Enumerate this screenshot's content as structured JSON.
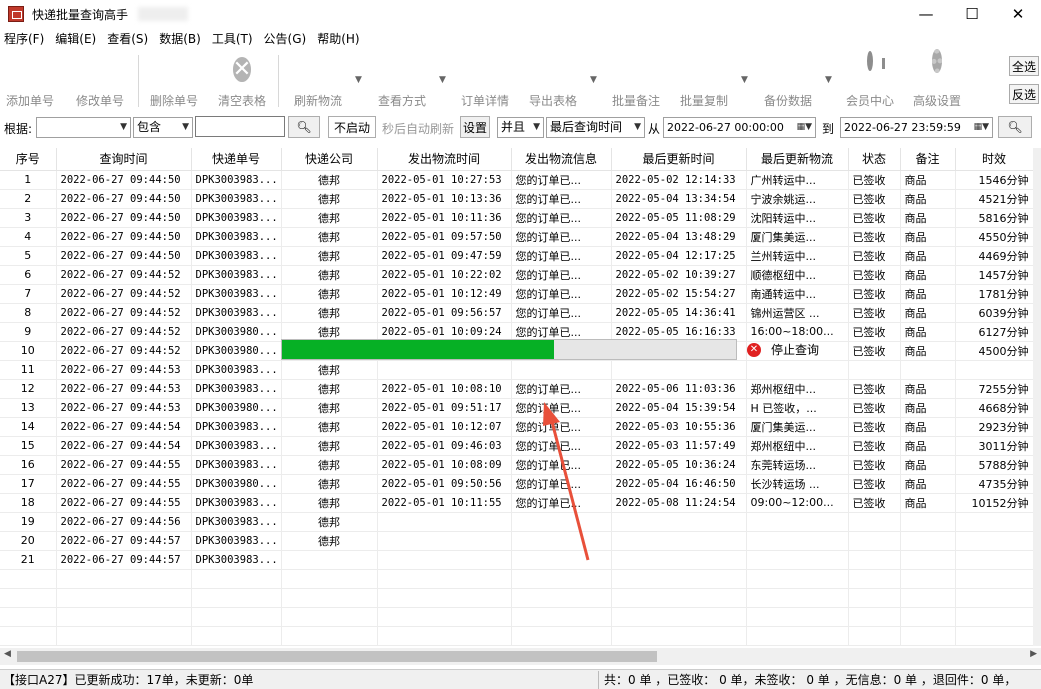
{
  "window": {
    "title": "快递批量查询高手",
    "min": "—",
    "max": "☐",
    "close": "✕"
  },
  "menu": [
    "程序(F)",
    "编辑(E)",
    "查看(S)",
    "数据(B)",
    "工具(T)",
    "公告(G)",
    "帮助(H)"
  ],
  "toolbar": {
    "add": "添加单号",
    "edit": "修改单号",
    "delete": "删除单号",
    "clear": "清空表格",
    "refresh": "刷新物流",
    "view_mode": "查看方式",
    "order_detail": "订单详情",
    "export": "导出表格",
    "batch_note": "批量备注",
    "batch_copy": "批量复制",
    "backup": "备份数据",
    "member": "会员中心",
    "advanced": "高级设置",
    "select_all": "全选",
    "invert": "反选"
  },
  "filter": {
    "by_label": "根据:",
    "field_value": "",
    "match_mode": "包含",
    "keyword": "",
    "auto_refresh": "不启动",
    "auto_refresh_hint": "秒后自动刷新",
    "settings": "设置",
    "logic": "并且",
    "time_field": "最后查询时间",
    "from_label": "从",
    "from_value": "2022-06-27 00:00:00",
    "to_label": "到",
    "to_value": "2022-06-27 23:59:59"
  },
  "columns": [
    "序号",
    "查询时间",
    "快递单号",
    "快递公司",
    "发出物流时间",
    "发出物流信息",
    "最后更新时间",
    "最后更新物流",
    "状态",
    "备注",
    "时效"
  ],
  "rows": [
    [
      "1",
      "2022-06-27 09:44:50",
      "DPK3003983...",
      "德邦",
      "2022-05-01 10:27:53",
      "您的订单已...",
      "2022-05-02 12:14:33",
      "广州转运中...",
      "已签收",
      "商品",
      "1546分钟"
    ],
    [
      "2",
      "2022-06-27 09:44:50",
      "DPK3003983...",
      "德邦",
      "2022-05-01 10:13:36",
      "您的订单已...",
      "2022-05-04 13:34:54",
      "宁波余姚运...",
      "已签收",
      "商品",
      "4521分钟"
    ],
    [
      "3",
      "2022-06-27 09:44:50",
      "DPK3003983...",
      "德邦",
      "2022-05-01 10:11:36",
      "您的订单已...",
      "2022-05-05 11:08:29",
      "沈阳转运中...",
      "已签收",
      "商品",
      "5816分钟"
    ],
    [
      "4",
      "2022-06-27 09:44:50",
      "DPK3003983...",
      "德邦",
      "2022-05-01 09:57:50",
      "您的订单已...",
      "2022-05-04 13:48:29",
      "厦门集美运...",
      "已签收",
      "商品",
      "4550分钟"
    ],
    [
      "5",
      "2022-06-27 09:44:50",
      "DPK3003983...",
      "德邦",
      "2022-05-01 09:47:59",
      "您的订单已...",
      "2022-05-04 12:17:25",
      "兰州转运中...",
      "已签收",
      "商品",
      "4469分钟"
    ],
    [
      "6",
      "2022-06-27 09:44:52",
      "DPK3003983...",
      "德邦",
      "2022-05-01 10:22:02",
      "您的订单已...",
      "2022-05-02 10:39:27",
      "顺德枢纽中...",
      "已签收",
      "商品",
      "1457分钟"
    ],
    [
      "7",
      "2022-06-27 09:44:52",
      "DPK3003983...",
      "德邦",
      "2022-05-01 10:12:49",
      "您的订单已...",
      "2022-05-02 15:54:27",
      "南通转运中...",
      "已签收",
      "商品",
      "1781分钟"
    ],
    [
      "8",
      "2022-06-27 09:44:52",
      "DPK3003983...",
      "德邦",
      "2022-05-01 09:56:57",
      "您的订单已...",
      "2022-05-05 14:36:41",
      "锦州运营区 ...",
      "已签收",
      "商品",
      "6039分钟"
    ],
    [
      "9",
      "2022-06-27 09:44:52",
      "DPK3003980...",
      "德邦",
      "2022-05-01 10:09:24",
      "您的订单已...",
      "2022-05-05 16:16:33",
      "16:00~18:00...",
      "已签收",
      "商品",
      "6127分钟"
    ],
    [
      "10",
      "2022-06-27 09:44:52",
      "DPK3003980...",
      "",
      "",
      "",
      "",
      "",
      "已签收",
      "商品",
      "4500分钟"
    ],
    [
      "11",
      "2022-06-27 09:44:53",
      "DPK3003983...",
      "德邦",
      "",
      "",
      "",
      "",
      "",
      "",
      ""
    ],
    [
      "12",
      "2022-06-27 09:44:53",
      "DPK3003983...",
      "德邦",
      "2022-05-01 10:08:10",
      "您的订单已...",
      "2022-05-06 11:03:36",
      "郑州枢纽中...",
      "已签收",
      "商品",
      "7255分钟"
    ],
    [
      "13",
      "2022-06-27 09:44:53",
      "DPK3003980...",
      "德邦",
      "2022-05-01 09:51:17",
      "您的订单已...",
      "2022-05-04 15:39:54",
      "H 已签收，...",
      "已签收",
      "商品",
      "4668分钟"
    ],
    [
      "14",
      "2022-06-27 09:44:54",
      "DPK3003983...",
      "德邦",
      "2022-05-01 10:12:07",
      "您的订单已...",
      "2022-05-03 10:55:36",
      "厦门集美运...",
      "已签收",
      "商品",
      "2923分钟"
    ],
    [
      "15",
      "2022-06-27 09:44:54",
      "DPK3003983...",
      "德邦",
      "2022-05-01 09:46:03",
      "您的订单已...",
      "2022-05-03 11:57:49",
      "郑州枢纽中...",
      "已签收",
      "商品",
      "3011分钟"
    ],
    [
      "16",
      "2022-06-27 09:44:55",
      "DPK3003983...",
      "德邦",
      "2022-05-01 10:08:09",
      "您的订单已...",
      "2022-05-05 10:36:24",
      "东莞转运场...",
      "已签收",
      "商品",
      "5788分钟"
    ],
    [
      "17",
      "2022-06-27 09:44:55",
      "DPK3003980...",
      "德邦",
      "2022-05-01 09:50:56",
      "您的订单已...",
      "2022-05-04 16:46:50",
      "长沙转运场 ...",
      "已签收",
      "商品",
      "4735分钟"
    ],
    [
      "18",
      "2022-06-27 09:44:55",
      "DPK3003983...",
      "德邦",
      "2022-05-01 10:11:55",
      "您的订单已...",
      "2022-05-08 11:24:54",
      "09:00~12:00...",
      "已签收",
      "商品",
      "10152分钟"
    ],
    [
      "19",
      "2022-06-27 09:44:56",
      "DPK3003983...",
      "德邦",
      "",
      "",
      "",
      "",
      "",
      "",
      ""
    ],
    [
      "20",
      "2022-06-27 09:44:57",
      "DPK3003983...",
      "德邦",
      "",
      "",
      "",
      "",
      "",
      "",
      ""
    ],
    [
      "21",
      "2022-06-27 09:44:57",
      "DPK3003983...",
      "",
      "",
      "",
      "",
      "",
      "",
      "",
      ""
    ]
  ],
  "progress": {
    "fraction": 0.6,
    "stop_label": "停止查询",
    "color": "#06b025"
  },
  "status": {
    "left": "【接口A27】已更新成功：17单，未更新：0单",
    "right": "共：0 单 ，已签收： 0 单，未签收： 0 单 ，无信息：0 单 ，退回件：0 单，"
  }
}
